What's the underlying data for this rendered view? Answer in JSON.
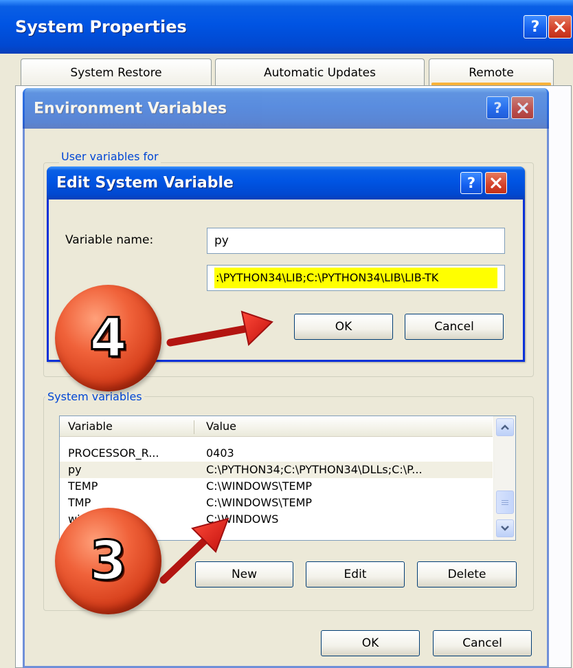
{
  "system_properties": {
    "title": "System Properties",
    "tabs": [
      "System Restore",
      "Automatic Updates",
      "Remote"
    ]
  },
  "env_vars": {
    "title": "Environment Variables",
    "user_group_label": "User variables for",
    "system_group_label": "System variables",
    "columns": [
      "Variable",
      "Value"
    ],
    "rows": [
      {
        "variable": "PROCESSOR_R...",
        "value": "0403"
      },
      {
        "variable": "py",
        "value": "C:\\PYTHON34;C:\\PYTHON34\\DLLs;C:\\P..."
      },
      {
        "variable": "TEMP",
        "value": "C:\\WINDOWS\\TEMP"
      },
      {
        "variable": "TMP",
        "value": "C:\\WINDOWS\\TEMP"
      },
      {
        "variable": "windir",
        "value": "C:\\WINDOWS"
      }
    ],
    "buttons": {
      "new": "New",
      "edit": "Edit",
      "delete": "Delete",
      "ok": "OK",
      "cancel": "Cancel"
    }
  },
  "edit_var": {
    "title": "Edit System Variable",
    "name_label": "Variable name:",
    "name_value": "py",
    "value_value": ":\\PYTHON34\\LIB;C:\\PYTHON34\\LIB\\LIB-TK",
    "ok": "OK",
    "cancel": "Cancel"
  },
  "annotations": {
    "step4": "4",
    "step3": "3"
  },
  "colors": {
    "xp_blue": "#0054e3",
    "dialog_face": "#ece9d8",
    "highlight_yellow": "#ffff00",
    "arrow_red": "#e0201a",
    "badge_orange": "#e2451a"
  },
  "icons": [
    "help-icon",
    "close-icon",
    "scroll-up-icon",
    "scroll-down-icon",
    "red-arrow",
    "step-badge"
  ]
}
